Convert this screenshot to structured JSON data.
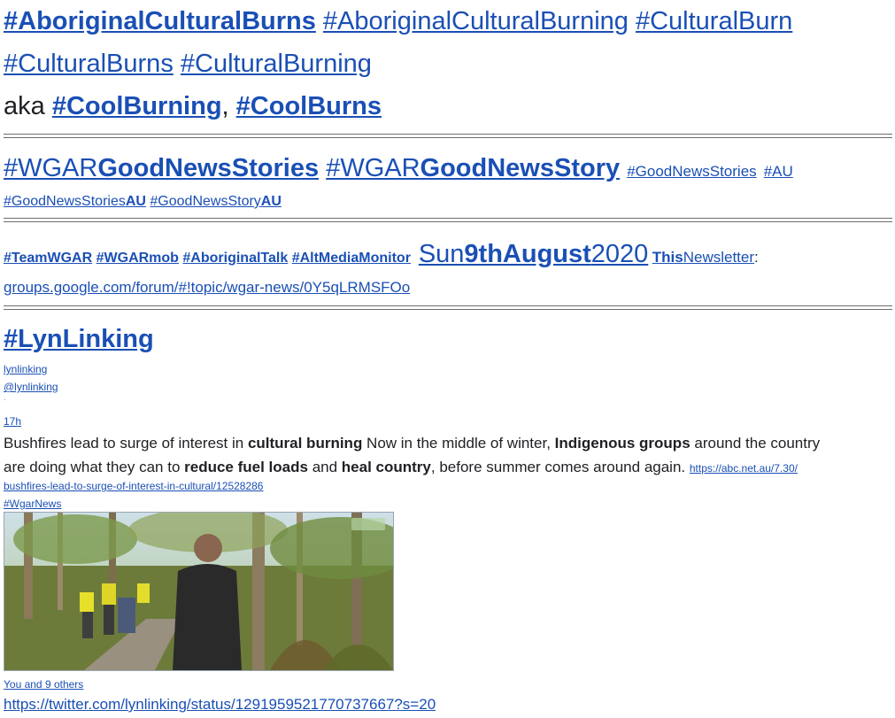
{
  "header": {
    "line1": [
      "#AboriginalCulturalBurns",
      "#AboriginalCulturalBurning",
      "#CulturalBurn"
    ],
    "line2": [
      "#CulturalBurns",
      "#CulturalBurning"
    ],
    "aka_text": "aka",
    "aka_tags": [
      "#CoolBurning",
      "#CoolBurns"
    ],
    "comma": ","
  },
  "goodnews": {
    "tag1_prefix": "#WGAR",
    "tag1_bold": "GoodNewsStories",
    "tag2_prefix": "#WGAR",
    "tag2_bold": "GoodNewsStory",
    "tag3": "#GoodNewsStories",
    "tag4": "#AU",
    "tag5_prefix": "#GoodNewsStories",
    "tag5_bold": "AU",
    "tag6_prefix": "#GoodNewsStory",
    "tag6_bold": "AU"
  },
  "meta": {
    "tags": [
      "#TeamWGAR",
      "#WGARmob",
      "#AboriginalTalk",
      "#AltMediaMonitor"
    ],
    "date_prefix": "Sun",
    "date_bold": "9thAugust",
    "date_suffix": "2020",
    "this_bold": "This",
    "this_rest": "Newsletter",
    "colon": ":",
    "group_link": "groups.google.com/forum/#!topic/wgar-news/0Y5qLRMSFOo"
  },
  "tweet": {
    "heading": "#LynLinking",
    "user": "lynlinking",
    "handle": "@lynlinking",
    "dot": "·",
    "time": "17h",
    "text_1": "Bushfires lead to surge of interest in ",
    "bold_1": "cultural burning",
    "text_2": " Now in the middle of winter, ",
    "bold_2": "Indigenous groups",
    "text_3": " around the country",
    "text_4": "are doing what they can to ",
    "bold_3": "reduce fuel loads",
    "text_5": " and ",
    "bold_4": "heal country",
    "text_6": ", before summer comes around again. ",
    "link_1": "https://abc.net.au/7.30/",
    "link_2": "bushfires-lead-to-surge-of-interest-in-cultural/12528286",
    "hashtag": "#WgarNews",
    "likes": "You and 9 others",
    "status_url": "https://twitter.com/lynlinking/status/1291959521770737667?s=20"
  },
  "colors": {
    "link": "#1a4fb5",
    "text": "#202124",
    "rule": "#6d6d6d"
  }
}
